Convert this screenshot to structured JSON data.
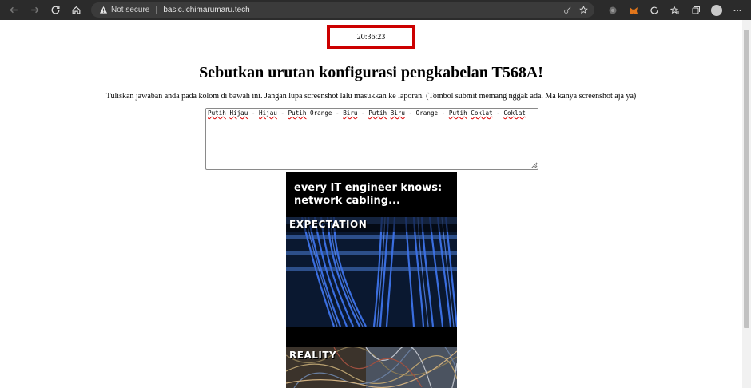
{
  "browser": {
    "security_label": "Not secure",
    "url": "basic.ichimarumaru.tech"
  },
  "timer": "20:36:23",
  "page": {
    "title": "Sebutkan urutan konfigurasi pengkabelan T568A!",
    "instructions": "Tuliskan jawaban anda pada kolom di bawah ini. Jangan lupa screenshot lalu masukkan ke laporan. (Tombol submit memang nggak ada. Ma kanya screenshot aja ya)"
  },
  "answer": {
    "tokens": [
      "Putih Hijau",
      "Hijau",
      "Putih Orange",
      "Biru",
      "Putih Biru",
      "Orange",
      "Putih Coklat",
      "Coklat"
    ],
    "words": {
      "w1": "Putih",
      "w2": "Hijau",
      "w3": "Hijau",
      "w4": "Putih",
      "w5": "Orange",
      "w6": "Biru",
      "w7": "Putih",
      "w8": "Biru",
      "w9": "Orange",
      "w10": "Putih",
      "w11": "Coklat",
      "w12": "Coklat"
    },
    "separator": " - "
  },
  "meme": {
    "caption_line1": "every IT engineer knows:",
    "caption_line2": "network cabling...",
    "label_expectation": "EXPECTATION",
    "label_reality": "REALITY"
  },
  "colors": {
    "timer_border": "#cc0000",
    "browser_chrome": "#2b2b2b",
    "cable_blue": "#2f5fd0"
  },
  "icons": [
    "back-icon",
    "forward-icon",
    "reload-icon",
    "home-icon",
    "warning-icon",
    "key-icon",
    "favorite-add-icon",
    "extension-icon",
    "metamask-icon",
    "puzzle-icon",
    "favorites-icon",
    "collections-icon",
    "profile-avatar",
    "more-icon"
  ]
}
